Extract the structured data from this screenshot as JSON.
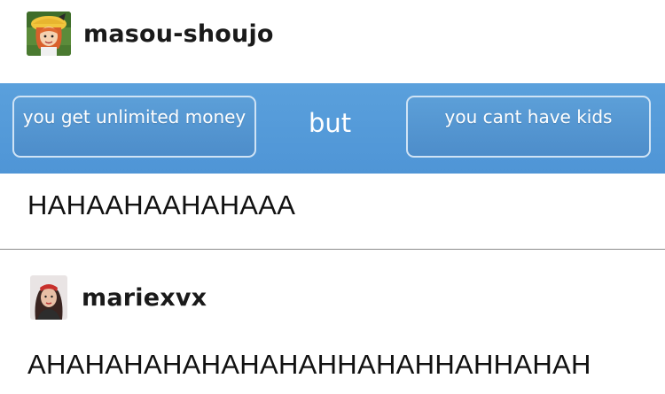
{
  "post1": {
    "username": "masou-shoujo",
    "meme": {
      "left_button": "you get unlimited money",
      "middle": "but",
      "right_button": "you cant have kids"
    },
    "text": "HAHAAHAAHAHAAA"
  },
  "post2": {
    "username": "mariexvx",
    "text": "AHAHAHAHAHAHAHAHHAHAHHAHHAHAH"
  },
  "colors": {
    "banner_blue": "#5aa0dc",
    "button_border": "#cfe3f5",
    "divider": "#8c8c8c"
  },
  "icons": {
    "avatar1": "cartoon-girl-avatar",
    "avatar2": "woman-photo-avatar"
  }
}
